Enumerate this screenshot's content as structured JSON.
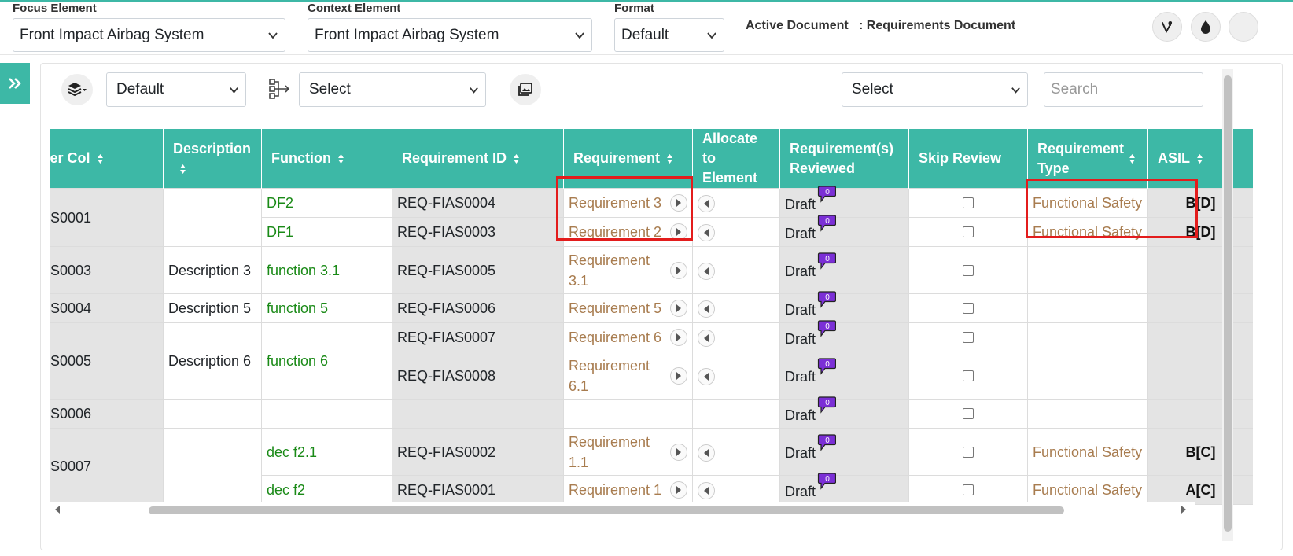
{
  "header": {
    "focus_label": "Focus Element",
    "focus_value": "Front Impact Airbag System",
    "context_label": "Context Element",
    "context_value": "Front Impact Airbag System",
    "format_label": "Format",
    "format_value": "Default",
    "active_doc_label": "Active Document",
    "active_doc_value": ": Requirements Document"
  },
  "toolbar": {
    "layer_select": "Default",
    "flow_select": "Select",
    "right_select": "Select",
    "search_placeholder": "Search"
  },
  "colors": {
    "accent": "#3db8a6",
    "highlight": "#e31c1c",
    "link_green": "#1a8a17",
    "req_brown": "#a87c4f",
    "badge_purple": "#7b2fd6"
  },
  "table": {
    "columns": [
      "er Col",
      "Description",
      "Function",
      "Requirement ID",
      "Requirement",
      "Allocate to Element",
      "Requirement(s) Reviewed",
      "Skip Review",
      "Requirement Type",
      "ASIL"
    ],
    "draft_label": "Draft",
    "comment_count": "0",
    "groups": [
      {
        "id": "S0001",
        "description": "",
        "rows": [
          {
            "function": "DF2",
            "req_id": "REQ-FIAS0004",
            "requirement": "Requirement 3",
            "type": "Functional Safety",
            "asil": "B[D]"
          },
          {
            "function": "DF1",
            "req_id": "REQ-FIAS0003",
            "requirement": "Requirement 2",
            "type": "Functional Safety",
            "asil": "B[D]"
          }
        ]
      },
      {
        "id": "S0003",
        "description": "Description 3",
        "rows": [
          {
            "function": "function 3.1",
            "req_id": "REQ-FIAS0005",
            "requirement": "Requirement 3.1",
            "type": "",
            "asil": ""
          }
        ]
      },
      {
        "id": "S0004",
        "description": "Description 5",
        "rows": [
          {
            "function": "function 5",
            "req_id": "REQ-FIAS0006",
            "requirement": "Requirement 5",
            "type": "",
            "asil": ""
          }
        ]
      },
      {
        "id": "S0005",
        "description": "Description 6",
        "function": "function 6",
        "rows": [
          {
            "req_id": "REQ-FIAS0007",
            "requirement": "Requirement 6",
            "type": "",
            "asil": ""
          },
          {
            "req_id": "REQ-FIAS0008",
            "requirement": "Requirement 6.1",
            "type": "",
            "asil": ""
          }
        ]
      },
      {
        "id": "S0006",
        "description": "",
        "rows": [
          {
            "function": "",
            "req_id": "",
            "requirement": "",
            "type": "",
            "asil": ""
          }
        ]
      },
      {
        "id": "S0007",
        "description": "",
        "rows": [
          {
            "function": "dec f2.1",
            "req_id": "REQ-FIAS0002",
            "requirement": "Requirement 1.1",
            "type": "Functional Safety",
            "asil": "B[C]"
          },
          {
            "function": "dec f2",
            "req_id": "REQ-FIAS0001",
            "requirement": "Requirement 1",
            "type": "Functional Safety",
            "asil": "A[C]"
          }
        ]
      }
    ]
  }
}
